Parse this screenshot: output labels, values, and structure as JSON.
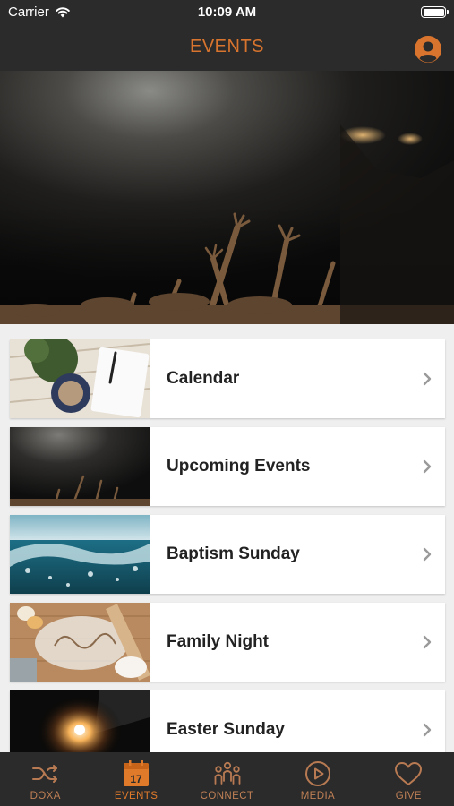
{
  "status_bar": {
    "carrier": "Carrier",
    "time": "10:09 AM",
    "battery_level": 1.0
  },
  "nav": {
    "title": "EVENTS",
    "profile_icon": "person-circle-icon"
  },
  "accent_color": "#d8742d",
  "hero": {
    "image": "worship-hands-raised-photo"
  },
  "events": {
    "items": [
      {
        "label": "Calendar",
        "thumbnail": "planner-desk-photo"
      },
      {
        "label": "Upcoming Events",
        "thumbnail": "worship-hands-photo"
      },
      {
        "label": "Baptism Sunday",
        "thumbnail": "water-wave-photo"
      },
      {
        "label": "Family Night",
        "thumbnail": "flour-family-baking-photo"
      },
      {
        "label": "Easter Sunday",
        "thumbnail": "light-burst-photo"
      }
    ]
  },
  "tabs": [
    {
      "label": "DOXA",
      "icon": "shuffle-icon",
      "active": false
    },
    {
      "label": "EVENTS",
      "icon": "calendar-icon",
      "icon_text": "17",
      "active": true
    },
    {
      "label": "CONNECT",
      "icon": "people-group-icon",
      "active": false
    },
    {
      "label": "MEDIA",
      "icon": "play-circle-icon",
      "active": false
    },
    {
      "label": "GIVE",
      "icon": "heart-icon",
      "active": false
    }
  ]
}
